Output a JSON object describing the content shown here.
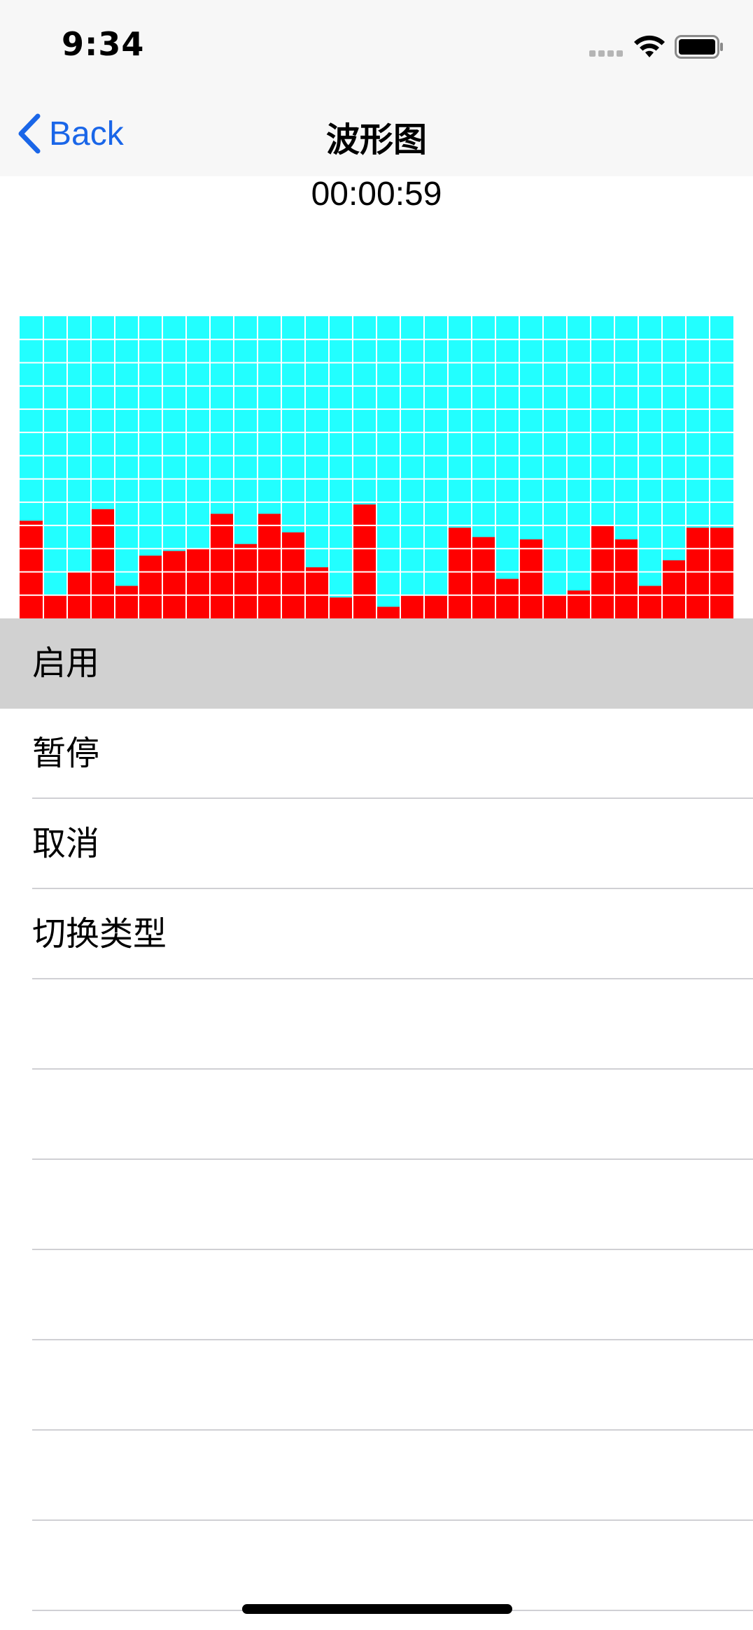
{
  "status_bar": {
    "time": "9:34",
    "icons": [
      "cellular-signal-icon",
      "wifi-icon",
      "battery-icon"
    ]
  },
  "nav_bar": {
    "back_label": "Back",
    "title": "波形图",
    "back_icon": "chevron-left-icon",
    "accent_color": "#1a66e8"
  },
  "timer": "00:00:59",
  "colors": {
    "waveform_background": "#22ffff",
    "waveform_bar": "#ff0000",
    "grid_line": "#ffffff",
    "selected_row": "#d1d1d1"
  },
  "chart_data": {
    "type": "bar",
    "grid_rows": 13,
    "grid_cols": 30,
    "ylim": [
      0,
      13
    ],
    "values": [
      4.2,
      1.0,
      2.0,
      4.7,
      1.4,
      2.7,
      2.9,
      3.0,
      4.5,
      3.2,
      4.5,
      3.7,
      2.2,
      0.9,
      4.9,
      0.5,
      1.0,
      1.0,
      3.9,
      3.5,
      1.7,
      3.4,
      1.0,
      1.2,
      4.0,
      3.4,
      1.4,
      2.5,
      3.9,
      3.9
    ]
  },
  "menu": {
    "items": [
      {
        "label": "启用",
        "selected": true
      },
      {
        "label": "暂停",
        "selected": false
      },
      {
        "label": "取消",
        "selected": false
      },
      {
        "label": "切换类型",
        "selected": false
      },
      {
        "label": "",
        "selected": false
      },
      {
        "label": "",
        "selected": false
      },
      {
        "label": "",
        "selected": false
      },
      {
        "label": "",
        "selected": false
      },
      {
        "label": "",
        "selected": false
      },
      {
        "label": "",
        "selected": false
      },
      {
        "label": "",
        "selected": false
      }
    ]
  }
}
